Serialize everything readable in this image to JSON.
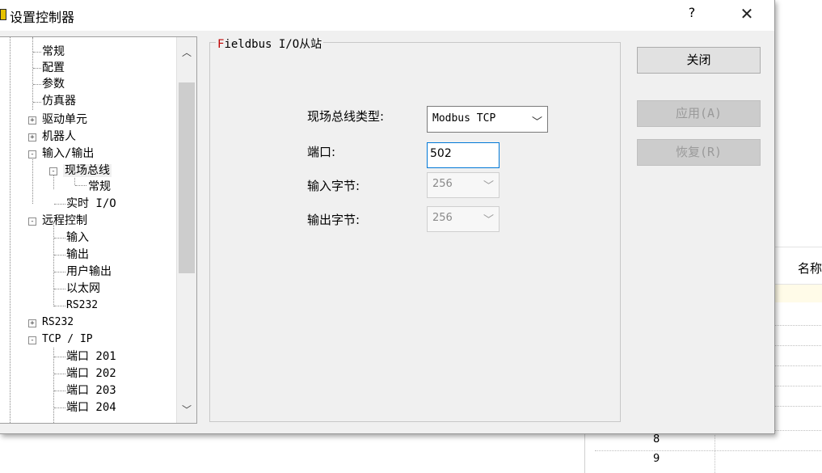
{
  "window": {
    "title": "设置控制器",
    "help": "?",
    "close": "✕"
  },
  "tree": {
    "items": [
      {
        "label": "常规"
      },
      {
        "label": "配置"
      },
      {
        "label": "参数"
      },
      {
        "label": "仿真器"
      },
      {
        "label": "驱动单元",
        "expander": "+"
      },
      {
        "label": "机器人",
        "expander": "+"
      },
      {
        "label": "输入/输出",
        "expander": "-"
      },
      {
        "label": "现场总线",
        "expander": "-"
      },
      {
        "label": "常规"
      },
      {
        "label": "实时 I/O"
      },
      {
        "label": "远程控制",
        "expander": "-"
      },
      {
        "label": "输入"
      },
      {
        "label": "输出"
      },
      {
        "label": "用户输出"
      },
      {
        "label": "以太网"
      },
      {
        "label": "RS232"
      },
      {
        "label": "RS232",
        "expander": "+"
      },
      {
        "label": "TCP / IP",
        "expander": "-"
      },
      {
        "label": "端口 201"
      },
      {
        "label": "端口 202"
      },
      {
        "label": "端口 203"
      },
      {
        "label": "端口 204"
      }
    ],
    "scroll_up": "︿",
    "scroll_down": "﹀"
  },
  "group": {
    "title_first": "F",
    "title_rest": "ieldbus I/O从站",
    "fieldbus_type_label": "现场总线类型:",
    "fieldbus_type_value": "Modbus TCP",
    "port_label": "端口:",
    "port_value": "502",
    "input_bytes_label": "输入字节:",
    "input_bytes_value": "256",
    "output_bytes_label": "输出字节:",
    "output_bytes_value": "256"
  },
  "buttons": {
    "close": "关闭",
    "apply": "应用(A)",
    "restore": "恢复(R)"
  },
  "background": {
    "column_header": "名称",
    "row_numbers": [
      "8",
      "9"
    ]
  },
  "colors": {
    "focus_border": "#0078d7",
    "icon_yellow": "#e6c200"
  }
}
